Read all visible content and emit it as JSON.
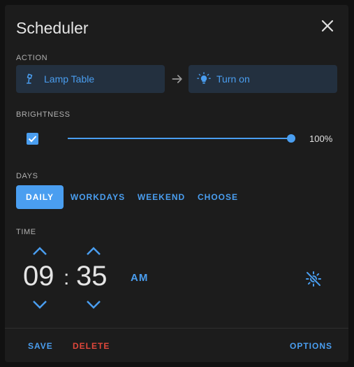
{
  "dialog": {
    "title": "Scheduler"
  },
  "icons": {
    "close": "close-icon",
    "entity": "lamp-icon",
    "service": "lightbulb-icon",
    "arrow": "arrow-right-icon",
    "check": "check-icon",
    "sun_off": "sun-off-icon"
  },
  "colors": {
    "accent": "#4a9ef0",
    "danger": "#e0473b",
    "action_bg": "#23303f",
    "dialog_bg": "#1c1c1c"
  },
  "action": {
    "label": "ACTION",
    "entity": "Lamp Table",
    "service": "Turn on"
  },
  "brightness": {
    "label": "BRIGHTNESS",
    "enabled": true,
    "value": 100,
    "display": "100%"
  },
  "days": {
    "label": "DAYS",
    "options": [
      "DAILY",
      "WORKDAYS",
      "WEEKEND",
      "CHOOSE"
    ],
    "selected": "DAILY"
  },
  "time": {
    "label": "TIME",
    "hours": "09",
    "separator": ":",
    "minutes": "35",
    "ampm": "AM"
  },
  "footer": {
    "save": "SAVE",
    "delete": "DELETE",
    "options": "OPTIONS"
  }
}
